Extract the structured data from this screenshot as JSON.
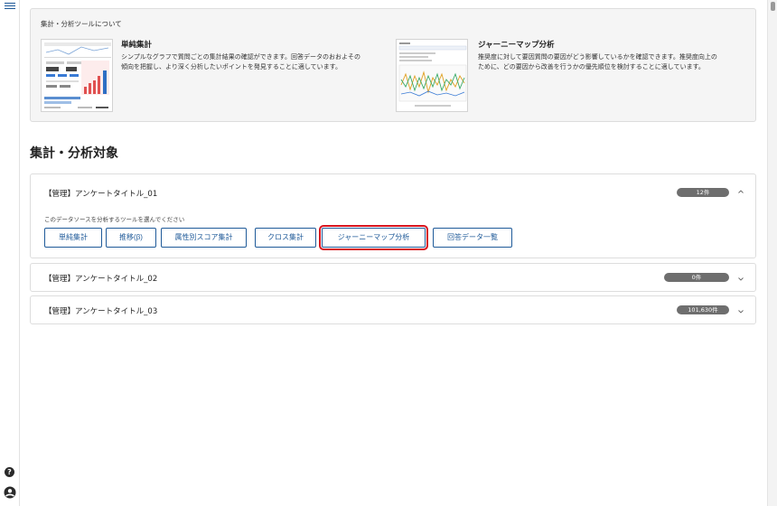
{
  "about": {
    "heading": "集計・分析ツールについて",
    "tools": [
      {
        "title": "単純集計",
        "description_lines": [
          "シンプルなグラフで質問ごとの集計結果の確認ができます。回答データのおおよその",
          "傾向を把握し、より深く分析したいポイントを発見することに適しています。"
        ]
      },
      {
        "title": "ジャーニーマップ分析",
        "description_lines": [
          "推奨度に対して要因質問の要因がどう影響しているかを確認できます。推奨度向上の",
          "ために、どの要因から改善を行うかの優先順位を検討することに適しています。"
        ]
      }
    ]
  },
  "section_title": "集計・分析対象",
  "surveys": [
    {
      "title": "【管理】アンケートタイトル_01",
      "count": "12件",
      "expanded": true,
      "prompt": "このデータソースを分析するツールを選んでください",
      "tools": [
        "単純集計",
        "推移(β)",
        "属性別スコア集計",
        "クロス集計",
        "ジャーニーマップ分析",
        "回答データ一覧"
      ],
      "highlighted_tool": "ジャーニーマップ分析"
    },
    {
      "title": "【管理】アンケートタイトル_02",
      "count": "0件",
      "expanded": false
    },
    {
      "title": "【管理】アンケートタイトル_03",
      "count": "101,630件",
      "expanded": false
    }
  ],
  "colors": {
    "accent": "#1f5a99",
    "highlight": "#d8141e",
    "badge": "#6e6e6e"
  },
  "icons": {
    "menu": "hamburger-icon",
    "help": "question-circle-icon",
    "user": "user-circle-icon"
  }
}
